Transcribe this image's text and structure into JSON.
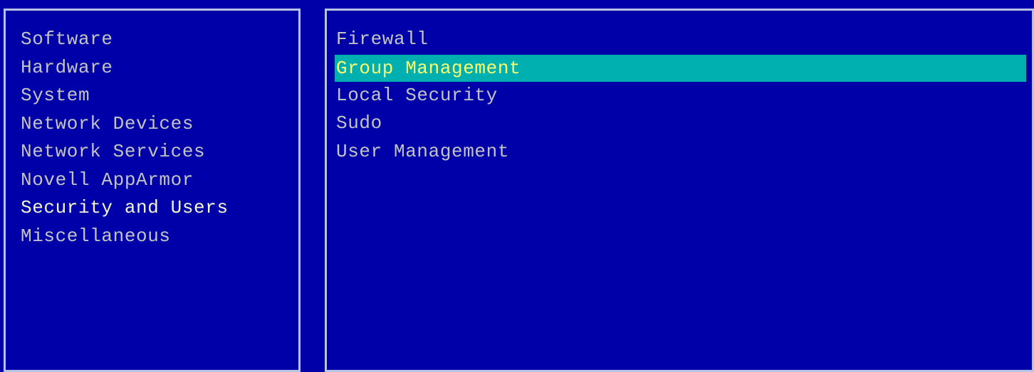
{
  "categories": {
    "items": [
      {
        "label": "Software"
      },
      {
        "label": "Hardware"
      },
      {
        "label": "System"
      },
      {
        "label": "Network Devices"
      },
      {
        "label": "Network Services"
      },
      {
        "label": "Novell AppArmor"
      },
      {
        "label": "Security and Users"
      },
      {
        "label": "Miscellaneous"
      }
    ],
    "active": "Security and Users"
  },
  "modules": {
    "items": [
      {
        "label": "Firewall"
      },
      {
        "label": "Group Management"
      },
      {
        "label": "Local Security"
      },
      {
        "label": "Sudo"
      },
      {
        "label": "User Management"
      }
    ],
    "selected": "Group Management"
  },
  "colors": {
    "background": "#0000a8",
    "border": "#b8c4e4",
    "text": "#c4c4c4",
    "active_text": "#f4f4d0",
    "highlight_bg": "#00b0b0",
    "highlight_text": "#ffff6a"
  }
}
